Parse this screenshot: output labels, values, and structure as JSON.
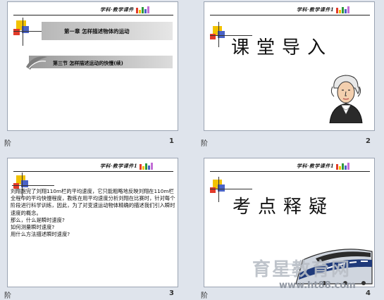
{
  "colors": {
    "band": "#c4c4c4",
    "accent_yellow": "#f2c200",
    "accent_blue": "#4a63c6",
    "accent_red": "#e23b2a"
  },
  "slides": [
    {
      "number": "1",
      "label": "阶",
      "header": "学科·教学课件",
      "chapter": "第一章   怎样描述物体的运动",
      "section": "第三节   怎样描述运动的快慢(续)"
    },
    {
      "number": "2",
      "label": "阶",
      "header": "学科·教学课件1",
      "title": "课堂导入",
      "image": "portrait-illustration"
    },
    {
      "number": "3",
      "label": "阶",
      "header": "学科·教学课件1",
      "paragraph": "刘翔跑完了刘翔110m栏的平均速度，它只能粗略地反映刘翔在110m栏全程中的平均快慢程度，教练在用平均速度分析刘翔在比赛时，针对每个阶段进行科学训练，因此，为了对变速运动物体精确的描述我们引入瞬时速度的概念。",
      "questions": [
        "那么，什么是瞬时速度?",
        "如何测量瞬时速度?",
        "用什么方法描述瞬时速度?"
      ]
    },
    {
      "number": "4",
      "label": "阶",
      "header": "学科·教学课件1",
      "title": "考点释疑",
      "image": "bullet-train-illustration",
      "watermark": "育星教育网",
      "watermark_url": "www.ht88.com"
    }
  ]
}
